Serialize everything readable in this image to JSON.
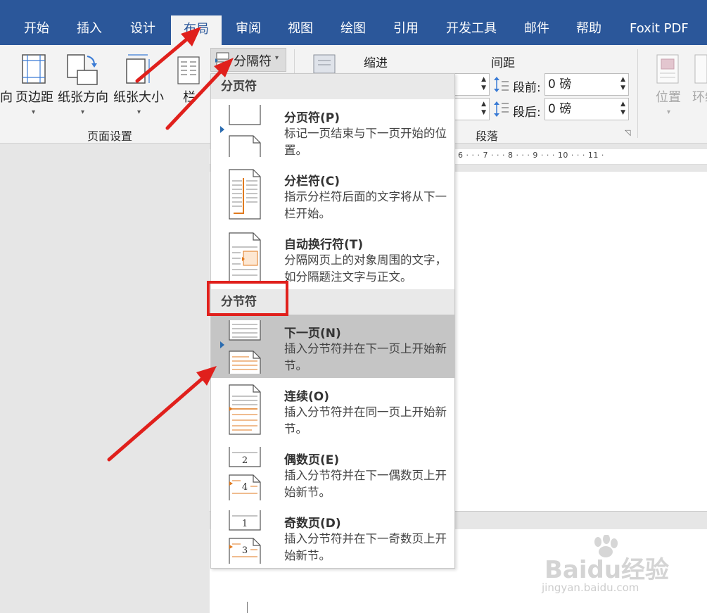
{
  "tabs": [
    "开始",
    "插入",
    "设计",
    "布局",
    "审阅",
    "视图",
    "绘图",
    "引用",
    "开发工具",
    "邮件",
    "帮助",
    "Foxit PDF"
  ],
  "ribbon": {
    "page_setup": {
      "direction_partial": "向",
      "margins": "页边距",
      "orientation": "纸张方向",
      "size": "纸张大小",
      "columns": "栏",
      "group_label": "页面设置"
    },
    "breaks_button": "分隔符",
    "paragraph": {
      "indent_label": "缩进",
      "spacing_label": "间距",
      "before_label": "段前:",
      "before_value": "0 磅",
      "after_label": "段后:",
      "after_value": "0 磅",
      "group_label": "段落"
    },
    "arrange": {
      "position": "位置",
      "wrap_partial": "环绕"
    }
  },
  "ruler": {
    "text": "· 6 · · · 7 · · · 8 · · · 9 · · · 10 · · · 11 ·"
  },
  "menu": {
    "page_breaks_header": "分页符",
    "section_breaks_header": "分节符",
    "items": [
      {
        "title": "分页符(P)",
        "desc": "标记一页结束与下一页开始的位置。"
      },
      {
        "title": "分栏符(C)",
        "desc": "指示分栏符后面的文字将从下一栏开始。"
      },
      {
        "title": "自动换行符(T)",
        "desc": "分隔网页上的对象周围的文字，如分隔题注文字与正文。"
      },
      {
        "title": "下一页(N)",
        "desc": "插入分节符并在下一页上开始新节。"
      },
      {
        "title": "连续(O)",
        "desc": "插入分节符并在同一页上开始新节。"
      },
      {
        "title": "偶数页(E)",
        "desc": "插入分节符并在下一偶数页上开始新节。"
      },
      {
        "title": "奇数页(D)",
        "desc": "插入分节符并在下一奇数页上开始新节。"
      }
    ],
    "even_icon_numbers": [
      "2",
      "4"
    ],
    "odd_icon_numbers": [
      "1",
      "3"
    ]
  },
  "watermark": {
    "main": "Baidu经验",
    "sub": "jingyan.baidu.com"
  },
  "colors": {
    "ribbon_blue": "#2b579a",
    "highlight_red": "#e0201c",
    "menu_highlight": "#c5c5c5"
  }
}
